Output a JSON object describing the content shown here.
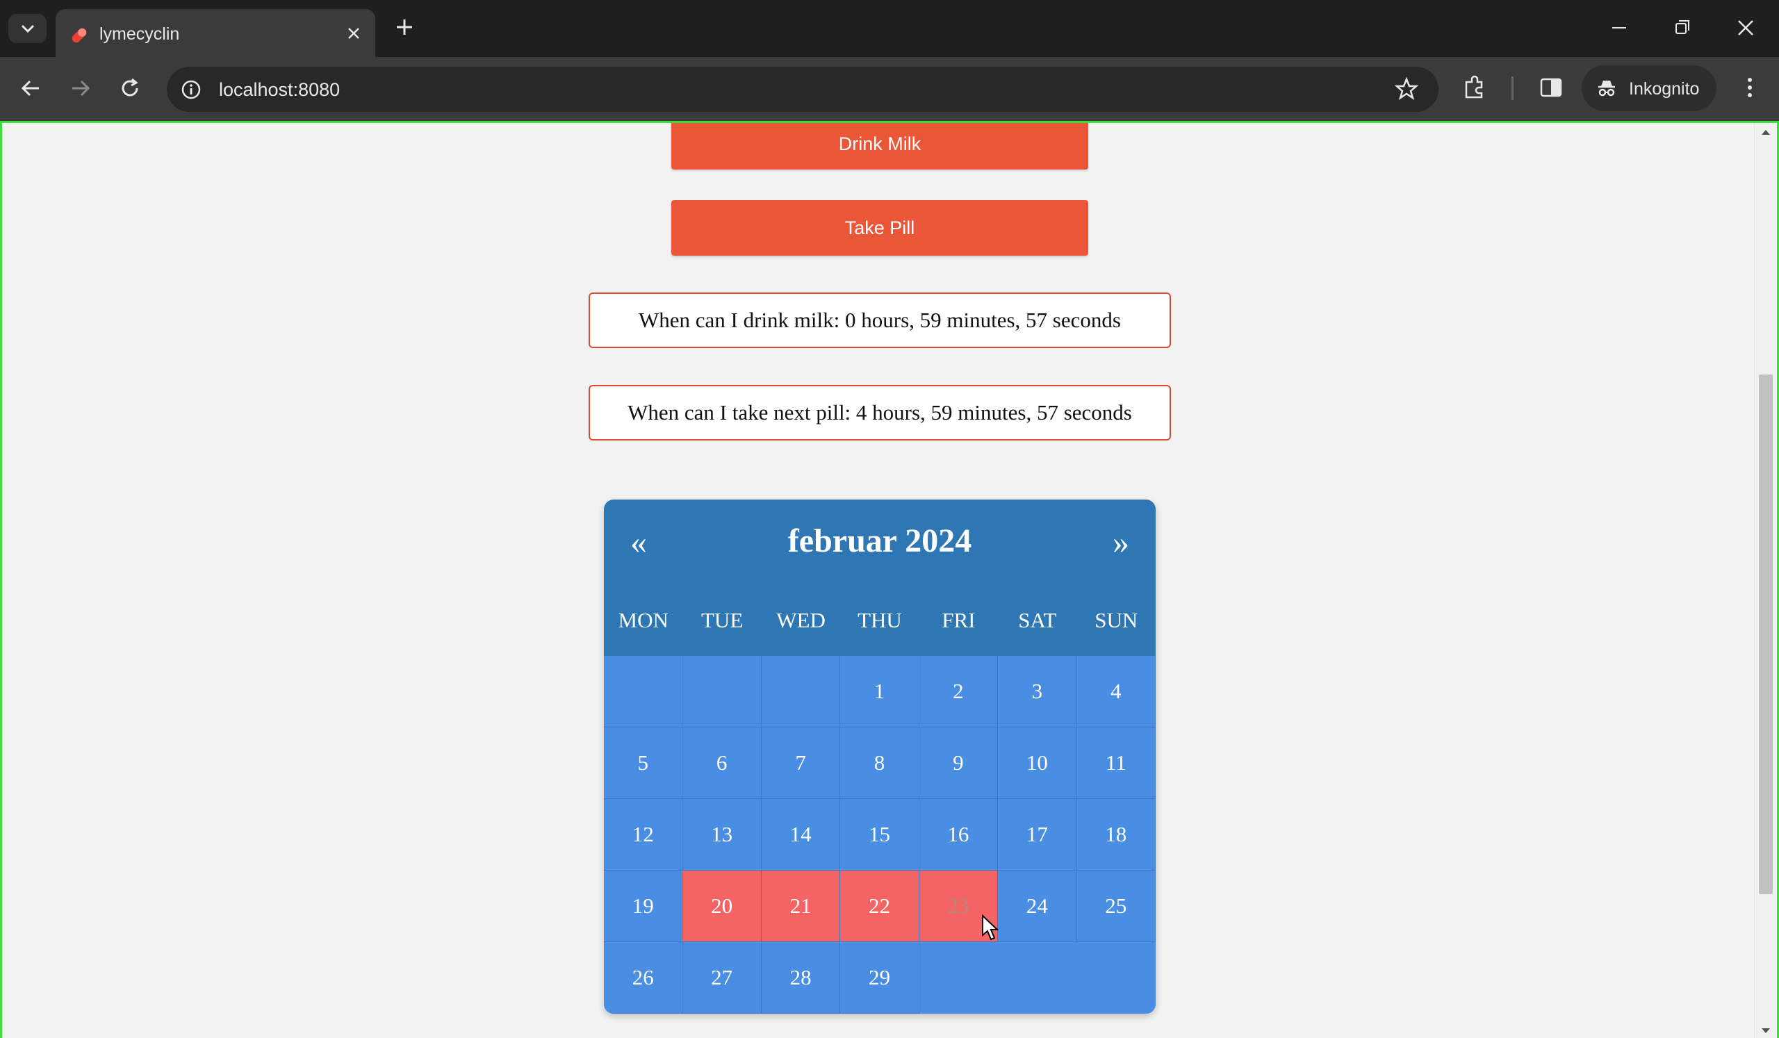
{
  "browser": {
    "tab_title": "lymecyclin",
    "url": "localhost:8080",
    "incognito_label": "Inkognito"
  },
  "actions": {
    "drink_milk": "Drink Milk",
    "take_pill": "Take Pill"
  },
  "status": {
    "milk": "When can I drink milk: 0 hours, 59 minutes, 57 seconds",
    "pill": "When can I take next pill: 4 hours, 59 minutes, 57 seconds"
  },
  "calendar": {
    "prev": "«",
    "next": "»",
    "title": "februar 2024",
    "weekdays": [
      "MON",
      "TUE",
      "WED",
      "THU",
      "FRI",
      "SAT",
      "SUN"
    ],
    "leading_blanks": 3,
    "days_in_month": 29,
    "marked_days": [
      20,
      21,
      22,
      23
    ],
    "hovered_day": 23,
    "colors": {
      "header": "#2f77b4",
      "cell": "#4a8ee3",
      "marked": "#f56464",
      "button": "#ec5638"
    }
  }
}
